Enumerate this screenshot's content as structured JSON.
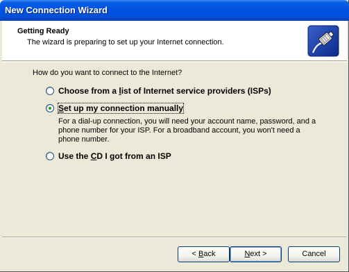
{
  "window": {
    "title": "New Connection Wizard"
  },
  "header": {
    "title": "Getting Ready",
    "subtitle": "The wizard is preparing to set up your Internet connection.",
    "icon": "connection-plug-icon"
  },
  "question": "How do you want to connect to the Internet?",
  "options": [
    {
      "pre": "Choose from a ",
      "key": "l",
      "post": "ist of Internet service providers (ISPs)",
      "selected": false
    },
    {
      "pre": "",
      "key": "S",
      "post": "et up my connection manually",
      "selected": true,
      "description": "For a dial-up connection, you will need your account name, password, and a phone number for your ISP. For a broadband account, you won't need a phone number."
    },
    {
      "pre": "Use the ",
      "key": "C",
      "post": "D I got from an ISP",
      "selected": false
    }
  ],
  "buttons": {
    "back": {
      "pre": "< ",
      "key": "B",
      "post": "ack"
    },
    "next": {
      "pre": "",
      "key": "N",
      "post": "ext >"
    },
    "cancel": "Cancel"
  },
  "colors": {
    "titlebar": "#0054e3",
    "face": "#ece9d8",
    "radio_dot": "#21a121"
  }
}
